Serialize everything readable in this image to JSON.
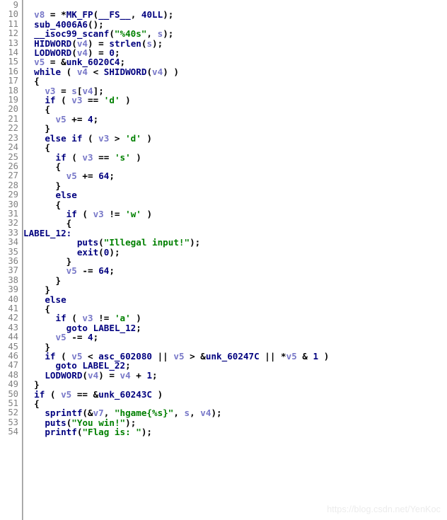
{
  "view": {
    "name": "hex-rays-pseudocode",
    "background": "#ffffff",
    "gutter_color": "#808080",
    "separator_color": "#9a9a9a"
  },
  "colors": {
    "keyword": "#00007f",
    "function": "#00007f",
    "variable": "#7878c8",
    "string": "#008000",
    "number": "#00007f",
    "global": "#00007f",
    "punctuation": "#000000",
    "line_number": "#808080",
    "watermark": "#ececec"
  },
  "watermark": {
    "text": "https://blog.csdn.net/YenKoc"
  },
  "code": {
    "first_line_number": 9,
    "last_line_number": 54,
    "lines": [
      {
        "n": "9",
        "tokens": []
      },
      {
        "n": "10",
        "tokens": [
          {
            "t": "  ",
            "c": "punc"
          },
          {
            "t": "v8",
            "c": "var"
          },
          {
            "t": " = *",
            "c": "punc"
          },
          {
            "t": "MK_FP",
            "c": "fn"
          },
          {
            "t": "(",
            "c": "punc"
          },
          {
            "t": "__FS__",
            "c": "kw"
          },
          {
            "t": ", ",
            "c": "punc"
          },
          {
            "t": "40LL",
            "c": "num"
          },
          {
            "t": ");",
            "c": "punc"
          }
        ]
      },
      {
        "n": "11",
        "tokens": [
          {
            "t": "  ",
            "c": "punc"
          },
          {
            "t": "sub_4006A6",
            "c": "fn"
          },
          {
            "t": "();",
            "c": "punc"
          }
        ]
      },
      {
        "n": "12",
        "tokens": [
          {
            "t": "  ",
            "c": "punc"
          },
          {
            "t": "__isoc99_scanf",
            "c": "fn"
          },
          {
            "t": "(",
            "c": "punc"
          },
          {
            "t": "\"%40s\"",
            "c": "str"
          },
          {
            "t": ", ",
            "c": "punc"
          },
          {
            "t": "s",
            "c": "var"
          },
          {
            "t": ");",
            "c": "punc"
          }
        ]
      },
      {
        "n": "13",
        "tokens": [
          {
            "t": "  ",
            "c": "punc"
          },
          {
            "t": "HIDWORD",
            "c": "fn"
          },
          {
            "t": "(",
            "c": "punc"
          },
          {
            "t": "v4",
            "c": "var"
          },
          {
            "t": ") = ",
            "c": "punc"
          },
          {
            "t": "strlen",
            "c": "fn"
          },
          {
            "t": "(",
            "c": "punc"
          },
          {
            "t": "s",
            "c": "var"
          },
          {
            "t": ");",
            "c": "punc"
          }
        ]
      },
      {
        "n": "14",
        "tokens": [
          {
            "t": "  ",
            "c": "punc"
          },
          {
            "t": "LODWORD",
            "c": "fn"
          },
          {
            "t": "(",
            "c": "punc"
          },
          {
            "t": "v4",
            "c": "var"
          },
          {
            "t": ") = ",
            "c": "punc"
          },
          {
            "t": "0",
            "c": "num"
          },
          {
            "t": ";",
            "c": "punc"
          }
        ]
      },
      {
        "n": "15",
        "tokens": [
          {
            "t": "  ",
            "c": "punc"
          },
          {
            "t": "v5",
            "c": "var"
          },
          {
            "t": " = &",
            "c": "punc"
          },
          {
            "t": "unk_6020C4",
            "c": "glob"
          },
          {
            "t": ";",
            "c": "punc"
          }
        ]
      },
      {
        "n": "16",
        "tokens": [
          {
            "t": "  ",
            "c": "punc"
          },
          {
            "t": "while",
            "c": "kw"
          },
          {
            "t": " ( ",
            "c": "punc"
          },
          {
            "t": "v4",
            "c": "var"
          },
          {
            "t": " < ",
            "c": "punc"
          },
          {
            "t": "SHIDWORD",
            "c": "fn"
          },
          {
            "t": "(",
            "c": "punc"
          },
          {
            "t": "v4",
            "c": "var"
          },
          {
            "t": ") )",
            "c": "punc"
          }
        ]
      },
      {
        "n": "17",
        "tokens": [
          {
            "t": "  {",
            "c": "punc"
          }
        ]
      },
      {
        "n": "18",
        "tokens": [
          {
            "t": "    ",
            "c": "punc"
          },
          {
            "t": "v3",
            "c": "var"
          },
          {
            "t": " = ",
            "c": "punc"
          },
          {
            "t": "s",
            "c": "var"
          },
          {
            "t": "[",
            "c": "punc"
          },
          {
            "t": "v4",
            "c": "var"
          },
          {
            "t": "];",
            "c": "punc"
          }
        ]
      },
      {
        "n": "19",
        "tokens": [
          {
            "t": "    ",
            "c": "punc"
          },
          {
            "t": "if",
            "c": "kw"
          },
          {
            "t": " ( ",
            "c": "punc"
          },
          {
            "t": "v3",
            "c": "var"
          },
          {
            "t": " == ",
            "c": "punc"
          },
          {
            "t": "'d'",
            "c": "str"
          },
          {
            "t": " )",
            "c": "punc"
          }
        ]
      },
      {
        "n": "20",
        "tokens": [
          {
            "t": "    {",
            "c": "punc"
          }
        ]
      },
      {
        "n": "21",
        "tokens": [
          {
            "t": "      ",
            "c": "punc"
          },
          {
            "t": "v5",
            "c": "var"
          },
          {
            "t": " += ",
            "c": "punc"
          },
          {
            "t": "4",
            "c": "num"
          },
          {
            "t": ";",
            "c": "punc"
          }
        ]
      },
      {
        "n": "22",
        "tokens": [
          {
            "t": "    }",
            "c": "punc"
          }
        ]
      },
      {
        "n": "23",
        "tokens": [
          {
            "t": "    ",
            "c": "punc"
          },
          {
            "t": "else if",
            "c": "kw"
          },
          {
            "t": " ( ",
            "c": "punc"
          },
          {
            "t": "v3",
            "c": "var"
          },
          {
            "t": " > ",
            "c": "punc"
          },
          {
            "t": "'d'",
            "c": "str"
          },
          {
            "t": " )",
            "c": "punc"
          }
        ]
      },
      {
        "n": "24",
        "tokens": [
          {
            "t": "    {",
            "c": "punc"
          }
        ]
      },
      {
        "n": "25",
        "tokens": [
          {
            "t": "      ",
            "c": "punc"
          },
          {
            "t": "if",
            "c": "kw"
          },
          {
            "t": " ( ",
            "c": "punc"
          },
          {
            "t": "v3",
            "c": "var"
          },
          {
            "t": " == ",
            "c": "punc"
          },
          {
            "t": "'s'",
            "c": "str"
          },
          {
            "t": " )",
            "c": "punc"
          }
        ]
      },
      {
        "n": "26",
        "tokens": [
          {
            "t": "      {",
            "c": "punc"
          }
        ]
      },
      {
        "n": "27",
        "tokens": [
          {
            "t": "        ",
            "c": "punc"
          },
          {
            "t": "v5",
            "c": "var"
          },
          {
            "t": " += ",
            "c": "punc"
          },
          {
            "t": "64",
            "c": "num"
          },
          {
            "t": ";",
            "c": "punc"
          }
        ]
      },
      {
        "n": "28",
        "tokens": [
          {
            "t": "      }",
            "c": "punc"
          }
        ]
      },
      {
        "n": "29",
        "tokens": [
          {
            "t": "      ",
            "c": "punc"
          },
          {
            "t": "else",
            "c": "kw"
          }
        ]
      },
      {
        "n": "30",
        "tokens": [
          {
            "t": "      {",
            "c": "punc"
          }
        ]
      },
      {
        "n": "31",
        "tokens": [
          {
            "t": "        ",
            "c": "punc"
          },
          {
            "t": "if",
            "c": "kw"
          },
          {
            "t": " ( ",
            "c": "punc"
          },
          {
            "t": "v3",
            "c": "var"
          },
          {
            "t": " != ",
            "c": "punc"
          },
          {
            "t": "'w'",
            "c": "str"
          },
          {
            "t": " )",
            "c": "punc"
          }
        ]
      },
      {
        "n": "32",
        "tokens": [
          {
            "t": "        {",
            "c": "punc"
          }
        ]
      },
      {
        "n": "33",
        "tokens": [
          {
            "t": "LABEL_12:",
            "c": "lbl"
          }
        ]
      },
      {
        "n": "34",
        "tokens": [
          {
            "t": "          ",
            "c": "punc"
          },
          {
            "t": "puts",
            "c": "fn"
          },
          {
            "t": "(",
            "c": "punc"
          },
          {
            "t": "\"Illegal input!\"",
            "c": "str"
          },
          {
            "t": ");",
            "c": "punc"
          }
        ]
      },
      {
        "n": "35",
        "tokens": [
          {
            "t": "          ",
            "c": "punc"
          },
          {
            "t": "exit",
            "c": "fn"
          },
          {
            "t": "(",
            "c": "punc"
          },
          {
            "t": "0",
            "c": "num"
          },
          {
            "t": ");",
            "c": "punc"
          }
        ]
      },
      {
        "n": "36",
        "tokens": [
          {
            "t": "        }",
            "c": "punc"
          }
        ]
      },
      {
        "n": "37",
        "tokens": [
          {
            "t": "        ",
            "c": "punc"
          },
          {
            "t": "v5",
            "c": "var"
          },
          {
            "t": " -= ",
            "c": "punc"
          },
          {
            "t": "64",
            "c": "num"
          },
          {
            "t": ";",
            "c": "punc"
          }
        ]
      },
      {
        "n": "38",
        "tokens": [
          {
            "t": "      }",
            "c": "punc"
          }
        ]
      },
      {
        "n": "39",
        "tokens": [
          {
            "t": "    }",
            "c": "punc"
          }
        ]
      },
      {
        "n": "40",
        "tokens": [
          {
            "t": "    ",
            "c": "punc"
          },
          {
            "t": "else",
            "c": "kw"
          }
        ]
      },
      {
        "n": "41",
        "tokens": [
          {
            "t": "    {",
            "c": "punc"
          }
        ]
      },
      {
        "n": "42",
        "tokens": [
          {
            "t": "      ",
            "c": "punc"
          },
          {
            "t": "if",
            "c": "kw"
          },
          {
            "t": " ( ",
            "c": "punc"
          },
          {
            "t": "v3",
            "c": "var"
          },
          {
            "t": " != ",
            "c": "punc"
          },
          {
            "t": "'a'",
            "c": "str"
          },
          {
            "t": " )",
            "c": "punc"
          }
        ]
      },
      {
        "n": "43",
        "tokens": [
          {
            "t": "        ",
            "c": "punc"
          },
          {
            "t": "goto",
            "c": "kw"
          },
          {
            "t": " ",
            "c": "punc"
          },
          {
            "t": "LABEL_12",
            "c": "lbl"
          },
          {
            "t": ";",
            "c": "punc"
          }
        ]
      },
      {
        "n": "44",
        "tokens": [
          {
            "t": "      ",
            "c": "punc"
          },
          {
            "t": "v5",
            "c": "var"
          },
          {
            "t": " -= ",
            "c": "punc"
          },
          {
            "t": "4",
            "c": "num"
          },
          {
            "t": ";",
            "c": "punc"
          }
        ]
      },
      {
        "n": "45",
        "tokens": [
          {
            "t": "    }",
            "c": "punc"
          }
        ]
      },
      {
        "n": "46",
        "tokens": [
          {
            "t": "    ",
            "c": "punc"
          },
          {
            "t": "if",
            "c": "kw"
          },
          {
            "t": " ( ",
            "c": "punc"
          },
          {
            "t": "v5",
            "c": "var"
          },
          {
            "t": " < ",
            "c": "punc"
          },
          {
            "t": "asc_602080",
            "c": "glob"
          },
          {
            "t": " || ",
            "c": "punc"
          },
          {
            "t": "v5",
            "c": "var"
          },
          {
            "t": " > &",
            "c": "punc"
          },
          {
            "t": "unk_60247C",
            "c": "glob"
          },
          {
            "t": " || *",
            "c": "punc"
          },
          {
            "t": "v5",
            "c": "var"
          },
          {
            "t": " & ",
            "c": "punc"
          },
          {
            "t": "1",
            "c": "num"
          },
          {
            "t": " )",
            "c": "punc"
          }
        ]
      },
      {
        "n": "47",
        "tokens": [
          {
            "t": "      ",
            "c": "punc"
          },
          {
            "t": "goto",
            "c": "kw"
          },
          {
            "t": " ",
            "c": "punc"
          },
          {
            "t": "LABEL_22",
            "c": "lbl"
          },
          {
            "t": ";",
            "c": "punc"
          }
        ]
      },
      {
        "n": "48",
        "tokens": [
          {
            "t": "    ",
            "c": "punc"
          },
          {
            "t": "LODWORD",
            "c": "fn"
          },
          {
            "t": "(",
            "c": "punc"
          },
          {
            "t": "v4",
            "c": "var"
          },
          {
            "t": ") = ",
            "c": "punc"
          },
          {
            "t": "v4",
            "c": "var"
          },
          {
            "t": " + ",
            "c": "punc"
          },
          {
            "t": "1",
            "c": "num"
          },
          {
            "t": ";",
            "c": "punc"
          }
        ]
      },
      {
        "n": "49",
        "tokens": [
          {
            "t": "  }",
            "c": "punc"
          }
        ]
      },
      {
        "n": "50",
        "tokens": [
          {
            "t": "  ",
            "c": "punc"
          },
          {
            "t": "if",
            "c": "kw"
          },
          {
            "t": " ( ",
            "c": "punc"
          },
          {
            "t": "v5",
            "c": "var"
          },
          {
            "t": " == &",
            "c": "punc"
          },
          {
            "t": "unk_60243C",
            "c": "glob"
          },
          {
            "t": " )",
            "c": "punc"
          }
        ]
      },
      {
        "n": "51",
        "tokens": [
          {
            "t": "  {",
            "c": "punc"
          }
        ]
      },
      {
        "n": "52",
        "tokens": [
          {
            "t": "    ",
            "c": "punc"
          },
          {
            "t": "sprintf",
            "c": "fn"
          },
          {
            "t": "(&",
            "c": "punc"
          },
          {
            "t": "v7",
            "c": "var"
          },
          {
            "t": ", ",
            "c": "punc"
          },
          {
            "t": "\"hgame{%s}\"",
            "c": "str"
          },
          {
            "t": ", ",
            "c": "punc"
          },
          {
            "t": "s",
            "c": "var"
          },
          {
            "t": ", ",
            "c": "punc"
          },
          {
            "t": "v4",
            "c": "var"
          },
          {
            "t": ");",
            "c": "punc"
          }
        ]
      },
      {
        "n": "53",
        "tokens": [
          {
            "t": "    ",
            "c": "punc"
          },
          {
            "t": "puts",
            "c": "fn"
          },
          {
            "t": "(",
            "c": "punc"
          },
          {
            "t": "\"You win!\"",
            "c": "str"
          },
          {
            "t": ");",
            "c": "punc"
          }
        ]
      },
      {
        "n": "54",
        "tokens": [
          {
            "t": "    ",
            "c": "punc"
          },
          {
            "t": "printf",
            "c": "fn"
          },
          {
            "t": "(",
            "c": "punc"
          },
          {
            "t": "\"Flag is: \"",
            "c": "str"
          },
          {
            "t": ");",
            "c": "punc"
          }
        ]
      }
    ]
  }
}
